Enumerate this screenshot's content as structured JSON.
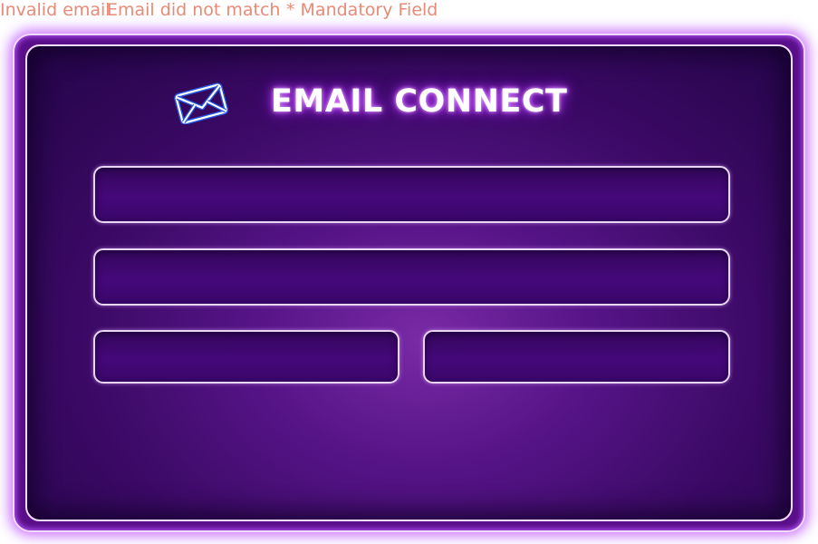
{
  "errors": {
    "invalid_email": "Invalid email",
    "email_mismatch": "Email did not match",
    "mandatory_field": "* Mandatory Field"
  },
  "form": {
    "title": "EMAIL CONNECT",
    "icon": "envelope-icon",
    "fields": [
      {
        "value": "",
        "placeholder": ""
      },
      {
        "value": "",
        "placeholder": ""
      },
      {
        "value": "",
        "placeholder": ""
      },
      {
        "value": "",
        "placeholder": ""
      }
    ]
  },
  "colors": {
    "error_text": "#e88a78",
    "panel_dark": "#230447",
    "panel_glow": "#7a2aa6",
    "frame_glow": "#b946ff",
    "title_text": "#ffffff",
    "icon_stroke": "#1f4fd6"
  }
}
